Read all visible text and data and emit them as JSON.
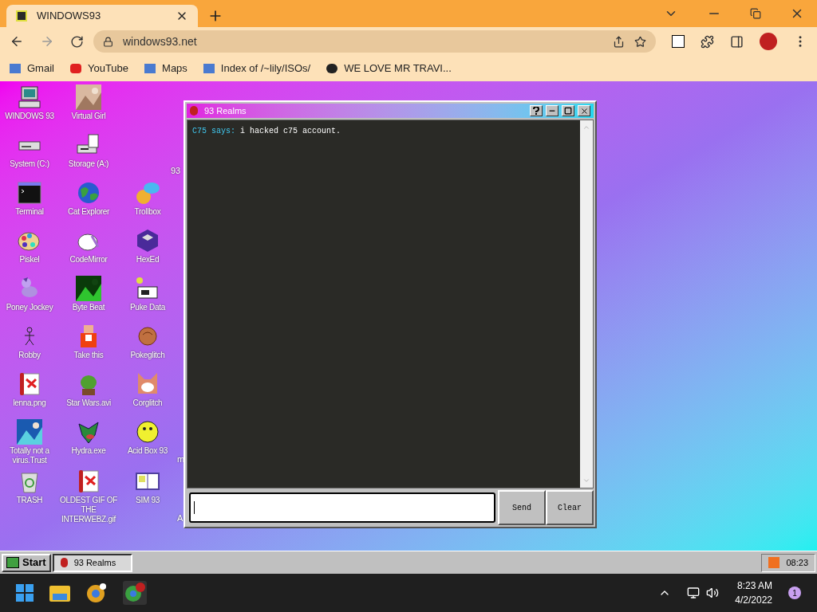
{
  "browser": {
    "tab": {
      "title": "WINDOWS93"
    },
    "address": "windows93.net",
    "bookmarks": [
      "Gmail",
      "YouTube",
      "Maps",
      "Index of /~lily/ISOs/",
      "WE LOVE MR TRAVI..."
    ]
  },
  "desktop": {
    "rows": [
      {
        "icons": [
          "WINDOWS 93",
          "Virtual Girl"
        ]
      },
      {
        "icons": [
          "System (C:)",
          "Storage (A:)"
        ],
        "edge_label": "93"
      },
      {
        "icons": [
          "Terminal",
          "Cat Explorer",
          "Trollbox"
        ]
      },
      {
        "icons": [
          "Piskel",
          "CodeMirror",
          "HexEd"
        ]
      },
      {
        "icons": [
          "Poney Jockey",
          "Byte Beat",
          "Puke Data"
        ]
      },
      {
        "icons": [
          "Robby",
          "Take this",
          "Pokeglitch"
        ]
      },
      {
        "icons": [
          "lenna.png",
          "Star Wars.avi",
          "Corglitch"
        ]
      },
      {
        "icons": [
          "Totally not a virus.Trust",
          "Hydra.exe",
          "Acid Box 93"
        ],
        "edge_label": "m"
      },
      {
        "icons": [
          "TRASH",
          "OLDEST GIF OF THE INTERWEBZ.gif",
          "SIM 93"
        ],
        "edge_label": "A"
      }
    ]
  },
  "window": {
    "title": "93 Realms",
    "messages": [
      {
        "user": "C75 says:",
        "text": "i hacked c75 account."
      }
    ],
    "input": {
      "focused": true
    },
    "buttons": [
      "Send",
      "Clear"
    ]
  },
  "taskbar": {
    "start": "Start",
    "tasks": [
      {
        "label": "93 Realms",
        "selected": true
      }
    ],
    "clock": "08:23"
  },
  "os_taskbar": {
    "time": "8:23 AM",
    "date": "4/2/2022",
    "notifications": "1"
  }
}
